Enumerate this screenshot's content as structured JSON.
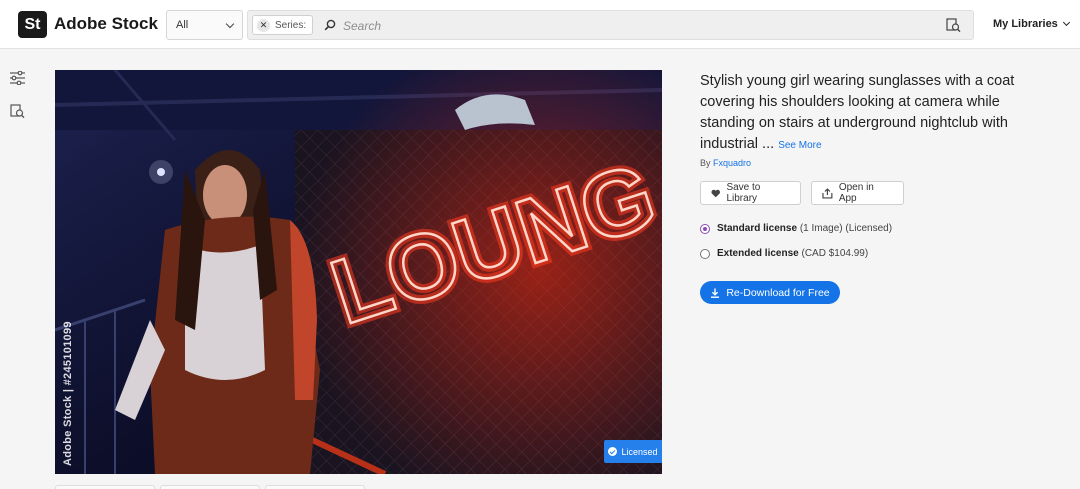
{
  "header": {
    "logo_badge": "St",
    "logo_text": "Adobe Stock",
    "category_value": "All",
    "series_chip": "Series:",
    "search_placeholder": "Search",
    "my_libraries": "My Libraries"
  },
  "asset": {
    "title": "Stylish young girl wearing sunglasses with a coat covering his shoulders looking at camera while standing on stairs at underground nightclub with industrial ...",
    "see_more": "See More",
    "by_label": "By",
    "author": "Fxquadro",
    "watermark_id": "Adobe Stock | #245101099",
    "licensed_badge": "Licensed",
    "neon_text": "LOUNG"
  },
  "actions": {
    "save_to_library": "Save to Library",
    "open_in_app": "Open in App",
    "redownload": "Re-Download for Free"
  },
  "licenses": {
    "standard_name": "Standard license",
    "standard_meta": "(1 Image) (Licensed)",
    "extended_name": "Extended license",
    "extended_meta": "(CAD $104.99)"
  },
  "colors": {
    "accent": "#1473e6",
    "badge": "#2680eb",
    "radio_selected": "#8a4bb3",
    "neon": "#ff3a1e"
  }
}
